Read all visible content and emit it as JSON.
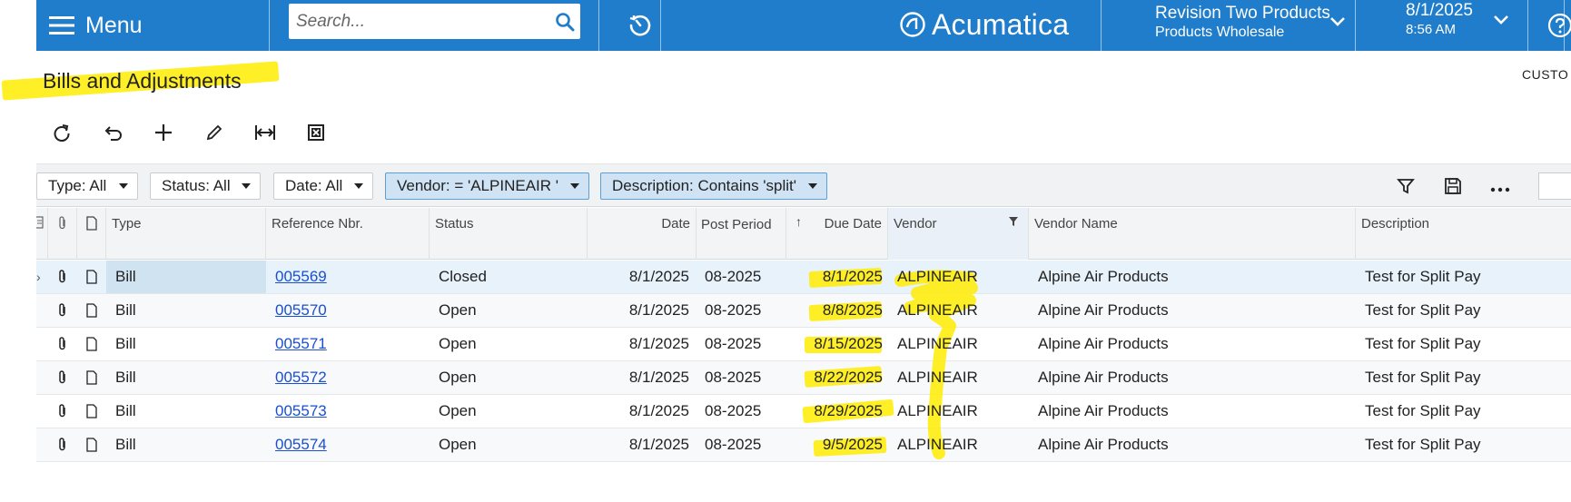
{
  "topbar": {
    "menu_label": "Menu",
    "search_placeholder": "Search...",
    "brand_name": "Acumatica",
    "company_name": "Revision Two Products",
    "company_branch": "Products Wholesale",
    "date": "8/1/2025",
    "time": "8:56 AM",
    "accent_color": "#1f7dcb"
  },
  "page": {
    "title": "Bills and Adjustments",
    "custo_label": "CUSTO"
  },
  "toolbar": {
    "icons": [
      "refresh-icon",
      "undo-icon",
      "add-icon",
      "edit-icon",
      "fit-columns-icon",
      "export-excel-icon"
    ]
  },
  "filters": {
    "chips": [
      {
        "label": "Type: All",
        "active": false
      },
      {
        "label": "Status: All",
        "active": false
      },
      {
        "label": "Date: All",
        "active": false
      },
      {
        "label": "Vendor: = 'ALPINEAIR '",
        "active": true
      },
      {
        "label": "Description: Contains 'split'",
        "active": true
      }
    ]
  },
  "grid": {
    "headers": {
      "type": "Type",
      "reference_nbr": "Reference Nbr.",
      "status": "Status",
      "date": "Date",
      "post_period": "Post Period",
      "sort_arrow": "↑",
      "due_date": "Due Date",
      "vendor": "Vendor",
      "vendor_name": "Vendor Name",
      "description": "Description"
    },
    "rows": [
      {
        "type": "Bill",
        "ref": "005569",
        "status": "Closed",
        "date": "8/1/2025",
        "period": "08-2025",
        "due": "8/1/2025",
        "vendor": "ALPINEAIR",
        "vendor_name": "Alpine Air Products",
        "description": "Test for Split Pay"
      },
      {
        "type": "Bill",
        "ref": "005570",
        "status": "Open",
        "date": "8/1/2025",
        "period": "08-2025",
        "due": "8/8/2025",
        "vendor": "ALPINEAIR",
        "vendor_name": "Alpine Air Products",
        "description": "Test for Split Pay"
      },
      {
        "type": "Bill",
        "ref": "005571",
        "status": "Open",
        "date": "8/1/2025",
        "period": "08-2025",
        "due": "8/15/2025",
        "vendor": "ALPINEAIR",
        "vendor_name": "Alpine Air Products",
        "description": "Test for Split Pay"
      },
      {
        "type": "Bill",
        "ref": "005572",
        "status": "Open",
        "date": "8/1/2025",
        "period": "08-2025",
        "due": "8/22/2025",
        "vendor": "ALPINEAIR",
        "vendor_name": "Alpine Air Products",
        "description": "Test for Split Pay"
      },
      {
        "type": "Bill",
        "ref": "005573",
        "status": "Open",
        "date": "8/1/2025",
        "period": "08-2025",
        "due": "8/29/2025",
        "vendor": "ALPINEAIR",
        "vendor_name": "Alpine Air Products",
        "description": "Test for Split Pay"
      },
      {
        "type": "Bill",
        "ref": "005574",
        "status": "Open",
        "date": "8/1/2025",
        "period": "08-2025",
        "due": "9/5/2025",
        "vendor": "ALPINEAIR",
        "vendor_name": "Alpine Air Products",
        "description": "Test for Split Pay"
      }
    ]
  },
  "annotations": {
    "highlighter_color": "#ffec00"
  }
}
